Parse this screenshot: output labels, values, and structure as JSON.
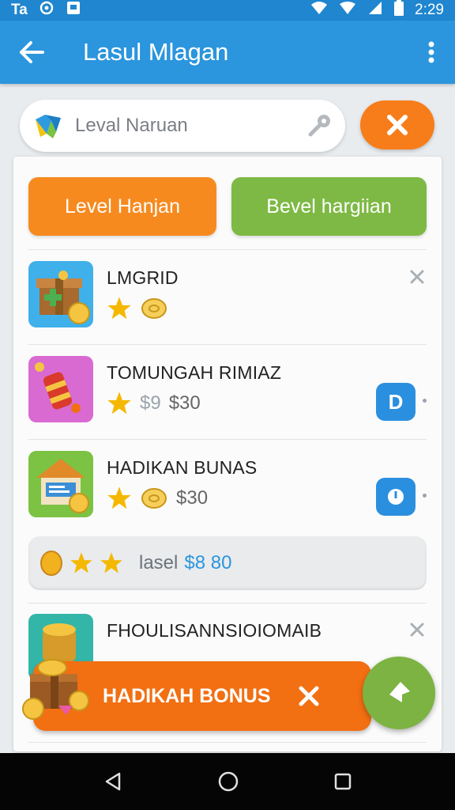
{
  "status_bar": {
    "left_text": "Ta",
    "time": "2:29",
    "icons": [
      "signal-icon",
      "sync-icon",
      "notification-icon",
      "wifi-icon",
      "cellular-icon",
      "battery-icon"
    ]
  },
  "app_bar": {
    "title": "Lasul Mlagan",
    "back_icon": "arrow-left-icon",
    "menu_icon": "more-vertical-icon"
  },
  "search": {
    "placeholder": "Leval Naruan",
    "leading_icon": "app-logo-icon",
    "trailing_icon": "microphone-icon"
  },
  "close_button": {
    "icon": "close-icon",
    "color": "#f77d1a"
  },
  "filters": [
    {
      "label": "Level Hanjan",
      "color": "#f78a1f"
    },
    {
      "label": "Bevel hargiian",
      "color": "#7db944"
    }
  ],
  "items": [
    {
      "name": "LMGRID",
      "icon": "gift-box-icon",
      "stars": 1,
      "price_old": "",
      "price": "",
      "action": "dismiss"
    },
    {
      "name": "TOMUNGAH RIMIAZ",
      "icon": "firecracker-icon",
      "stars": 1,
      "price_old": "$9",
      "price": "$30",
      "action_badge": "D"
    },
    {
      "name": "HADIKAN BUNAS",
      "icon": "shop-icon",
      "stars": 1,
      "price_old": "",
      "price": "$30",
      "action_badge": ""
    },
    {
      "name": "FHOULISANNSIOIOMAIB",
      "icon": "treasure-icon",
      "stars": 0,
      "price_old": "",
      "price": "",
      "action": "dismiss"
    }
  ],
  "summary": {
    "stars": 2,
    "label": "lasel",
    "amount": "$8 80"
  },
  "toast": {
    "label": "HADIKAH BONUS",
    "close_icon": "close-icon",
    "color": "#f26f12"
  },
  "fab": {
    "icon": "send-icon",
    "color": "#7cb342"
  },
  "nav_bar": [
    "back-triangle-icon",
    "home-circle-icon",
    "recents-square-icon"
  ]
}
